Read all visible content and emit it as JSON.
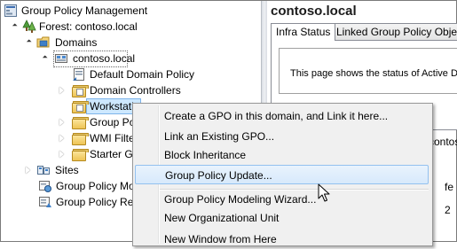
{
  "tree": {
    "root": "Group Policy Management",
    "forest": "Forest: contoso.local",
    "domains": "Domains",
    "domain": "contoso.local",
    "default_policy": "Default Domain Policy",
    "domain_controllers": "Domain Controllers",
    "workstations": "Workstati",
    "group_policy_objects": "Group Po",
    "wmi_filters": "WMI Filte",
    "starter_gpos": "Starter GP",
    "sites": "Sites",
    "modeling": "Group Policy Mo",
    "results": "Group Policy Res"
  },
  "right": {
    "title": "contoso.local",
    "tabs": [
      "Infra Status",
      "Linked Group Policy Objects"
    ],
    "status_text": "This page shows the status of Active Di",
    "frag1": "contos",
    "frag2": "fe",
    "frag3": "2"
  },
  "menu": {
    "items": [
      "Create a GPO in this domain, and Link it here...",
      "Link an Existing GPO...",
      "Block Inheritance",
      "Group Policy Update...",
      "Group Policy Modeling Wizard...",
      "New Organizational Unit",
      "New Window from Here"
    ],
    "highlighted_index": 3
  }
}
